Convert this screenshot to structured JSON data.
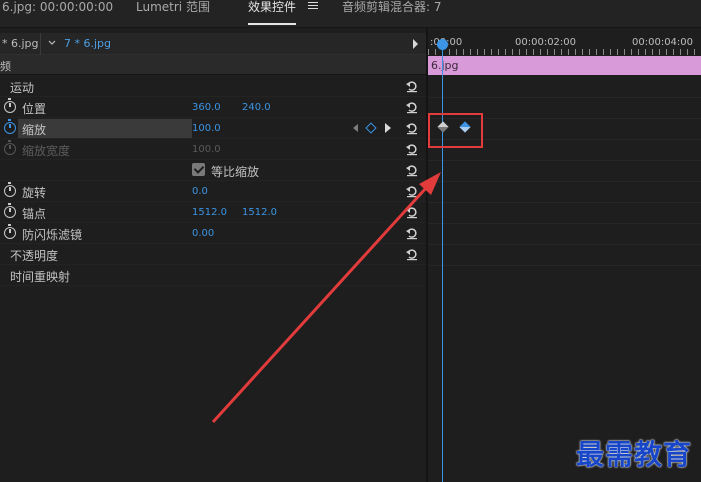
{
  "tabs": [
    {
      "label": "6.jpg: 00:00:00:00"
    },
    {
      "label": "Lumetri 范围"
    },
    {
      "label": "效果控件"
    },
    {
      "label": "音频剪辑混合器: 7"
    }
  ],
  "clip_bar": {
    "source": "* 6.jpg",
    "sequence": "7 * 6.jpg"
  },
  "section_header": "频",
  "effects": {
    "motion": "运动",
    "position": {
      "label": "位置",
      "x": "360.0",
      "y": "240.0"
    },
    "scale": {
      "label": "缩放",
      "value": "100.0"
    },
    "scale_width": {
      "label": "缩放宽度",
      "value": "100.0"
    },
    "uniform_scale": {
      "label": "等比缩放"
    },
    "rotation": {
      "label": "旋转",
      "value": "0.0"
    },
    "anchor": {
      "label": "锚点",
      "x": "1512.0",
      "y": "1512.0"
    },
    "anti_flicker": {
      "label": "防闪烁滤镜",
      "value": "0.00"
    },
    "opacity": "不透明度",
    "time_remap": "时间重映射"
  },
  "timeline": {
    "ruler": [
      ":00:00",
      "00:00:02:00",
      "00:00:04:00"
    ],
    "clip_name": "6.jpg"
  },
  "watermark": "最需教育",
  "colors": {
    "accent": "#3b94e4",
    "clip": "#d99ad9",
    "highlight": "#e23b3b"
  }
}
